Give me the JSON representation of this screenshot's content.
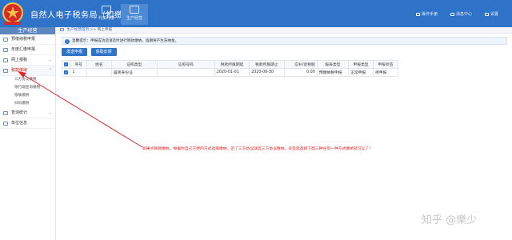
{
  "header": {
    "title": "自然人电子税务局（扣缴端）",
    "nav": [
      {
        "label": "代扣代缴",
        "icon": "document-icon"
      },
      {
        "label": "生产经营",
        "icon": "briefcase-icon",
        "active": true
      }
    ],
    "actions": [
      {
        "label": "操作手册",
        "icon": "book-icon"
      },
      {
        "label": "消息中心",
        "icon": "mail-icon"
      },
      {
        "label": "设置",
        "icon": "gear-icon"
      }
    ],
    "brand_color": "#2f73c9"
  },
  "sidebar": {
    "section_title": "生产经营",
    "items": [
      {
        "label": "预缴纳税申报"
      },
      {
        "label": "年度汇缴申报"
      },
      {
        "label": "网上报税"
      },
      {
        "label": "税款缴纳",
        "active": true,
        "expanded": true
      }
    ],
    "subitems": [
      "三方协议缴税",
      "银行端查询缴税",
      "银联缴税",
      "扫码缴税"
    ],
    "items_after": [
      {
        "label": "查询统计"
      },
      {
        "label": "单位信息"
      }
    ]
  },
  "breadcrumb": {
    "home": "生产经营首页",
    "separator": " >> ",
    "current": "网上申报"
  },
  "tip": {
    "icon": "i",
    "text": "温馨提示：申报成功后请及时进行税款缴纳，逾期将产生滞纳金。"
  },
  "buttons": {
    "send": "发送申报",
    "fetch": "获取反馈"
  },
  "table": {
    "headers": [
      "",
      "序号",
      "姓名",
      "证照类型",
      "证照号码",
      "税款所属期起",
      "税款所属期止",
      "应补/退税额",
      "报表类型",
      "申报类型",
      "申报状态"
    ],
    "rows": [
      [
        "✓",
        "1",
        "",
        "居民身份证",
        "",
        "2020-01-01",
        "2020-06-30",
        "0.00",
        "预缴纳税申报",
        "正常申报",
        "待申报"
      ]
    ]
  },
  "annotation": {
    "text": "如果点税款缴纳，根据你自己方便的方式选择缴纳，签了三方协议就选三方协议缴纳，没签就选择下面三种任何一种方式缴纳就可以了！",
    "color": "#e0262a"
  },
  "watermark": "知乎 @樂少"
}
